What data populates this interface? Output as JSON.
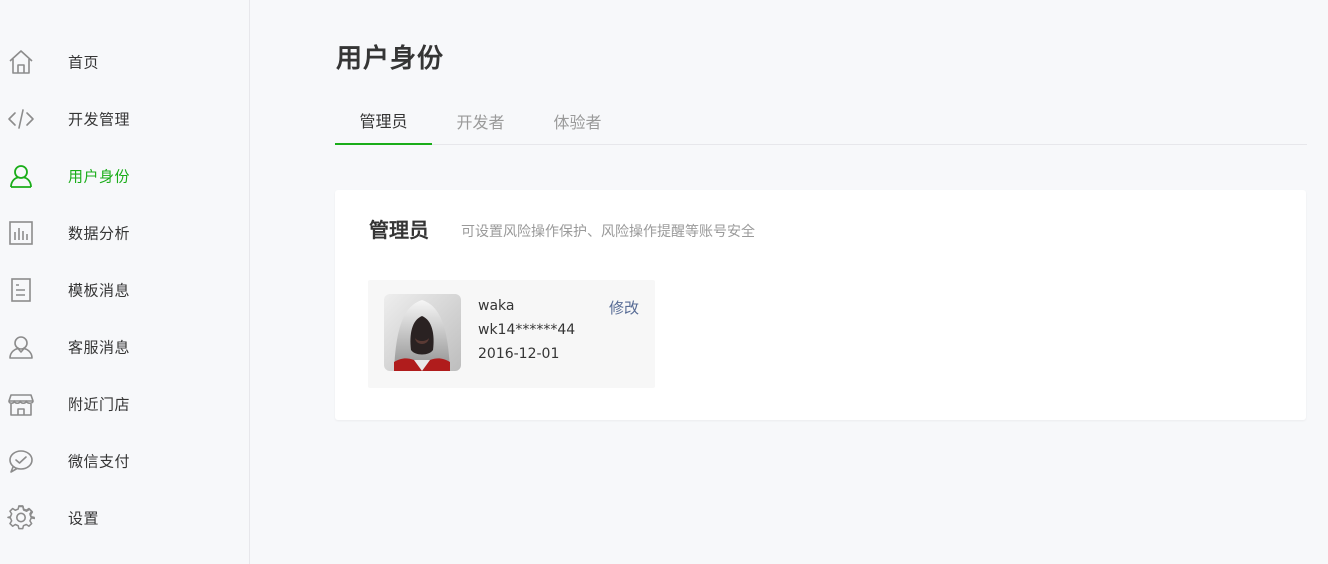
{
  "colors": {
    "accent": "#1aad19",
    "link": "#576b95",
    "text": "#353535",
    "muted": "#9a9a9a",
    "icon": "#8c8c8c"
  },
  "sidebar": {
    "items": [
      {
        "label": "首页",
        "icon": "home-icon",
        "active": false
      },
      {
        "label": "开发管理",
        "icon": "code-icon",
        "active": false
      },
      {
        "label": "用户身份",
        "icon": "user-icon",
        "active": true
      },
      {
        "label": "数据分析",
        "icon": "chart-icon",
        "active": false
      },
      {
        "label": "模板消息",
        "icon": "document-icon",
        "active": false
      },
      {
        "label": "客服消息",
        "icon": "service-icon",
        "active": false
      },
      {
        "label": "附近门店",
        "icon": "store-icon",
        "active": false
      },
      {
        "label": "微信支付",
        "icon": "payment-icon",
        "active": false
      },
      {
        "label": "设置",
        "icon": "gear-icon",
        "active": false
      }
    ]
  },
  "main": {
    "title": "用户身份",
    "tabs": [
      {
        "label": "管理员",
        "active": true
      },
      {
        "label": "开发者",
        "active": false
      },
      {
        "label": "体验者",
        "active": false
      }
    ],
    "card": {
      "title": "管理员",
      "description": "可设置风险操作保护、风险操作提醒等账号安全",
      "member": {
        "name": "waka",
        "account": "wk14******44",
        "date": "2016-12-01",
        "edit_label": "修改",
        "avatar_icon": "hooded-avatar"
      }
    }
  }
}
